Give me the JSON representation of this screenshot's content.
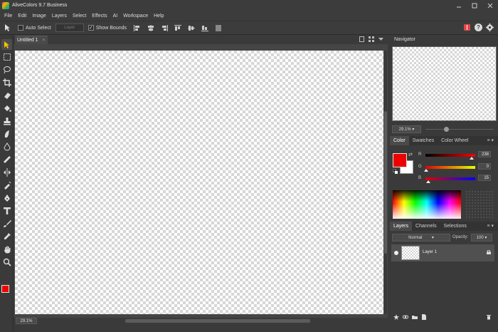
{
  "app": {
    "title": "AliveColors 9.7 Business",
    "window_controls": [
      "minimize",
      "maximize",
      "close"
    ]
  },
  "menu": [
    "File",
    "Edit",
    "Image",
    "Layers",
    "Select",
    "Effects",
    "AI",
    "Workspace",
    "Help"
  ],
  "options": {
    "auto_select_label": "Auto Select",
    "layer_select_value": "Layer",
    "show_bounds_label": "Show Bounds",
    "show_bounds_checked": true
  },
  "document": {
    "tab_title": "Untitled 1",
    "zoom": "29.1%"
  },
  "navigator": {
    "title": "Navigator",
    "zoom": "29.1%",
    "slider_level": 0.27
  },
  "color_panel": {
    "tabs": [
      "Color",
      "Swatches",
      "Color Wheel"
    ],
    "active_tab": "Color",
    "foreground": "#ee0000",
    "background": "#ffffff",
    "channels": [
      {
        "label": "R",
        "value": "238",
        "level": 0.93
      },
      {
        "label": "G",
        "value": "0",
        "level": 0.0
      },
      {
        "label": "B",
        "value": "15",
        "level": 0.06
      }
    ]
  },
  "layers_panel": {
    "tabs": [
      "Layers",
      "Channels",
      "Selections"
    ],
    "active_tab": "Layers",
    "blend_mode": "Normal",
    "opacity_label": "Opacity:",
    "opacity_value": "100",
    "layers": [
      {
        "name": "Layer 1"
      }
    ]
  },
  "colors": {
    "accent_red": "#ee0000",
    "panel_bg": "#3a3a3a"
  }
}
